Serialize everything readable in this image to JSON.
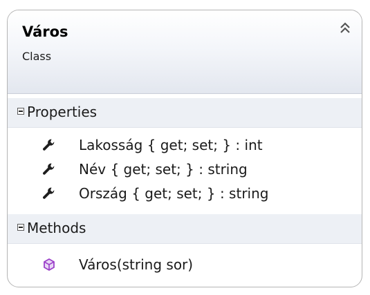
{
  "class": {
    "name": "Város",
    "kind": "Class"
  },
  "sections": [
    {
      "title": "Properties",
      "members": [
        {
          "text": "Lakosság { get; set; } : int",
          "icon": "wrench-icon"
        },
        {
          "text": "Név { get; set; } : string",
          "icon": "wrench-icon"
        },
        {
          "text": "Ország { get; set; } : string",
          "icon": "wrench-icon"
        }
      ]
    },
    {
      "title": "Methods",
      "members": [
        {
          "text": "Város(string sor)",
          "icon": "method-cube-icon"
        }
      ]
    }
  ],
  "colors": {
    "method_icon": "#9b3fc9",
    "property_icon": "#1e1e1e"
  }
}
